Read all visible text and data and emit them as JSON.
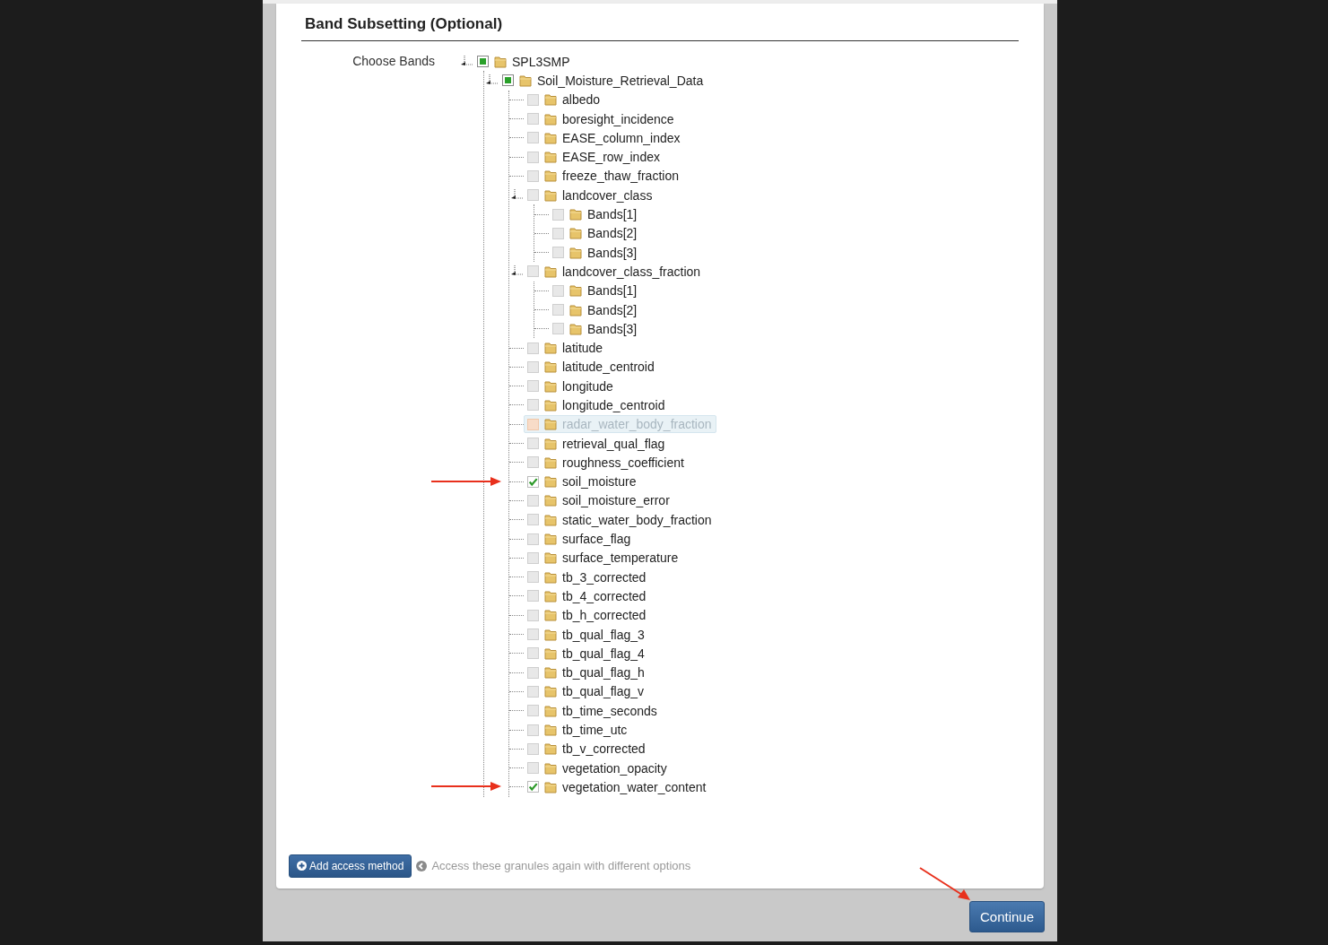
{
  "section": {
    "title": "Band Subsetting (Optional)"
  },
  "field_label": "Choose Bands",
  "tree": [
    {
      "label": "SPL3SMP",
      "checked": false,
      "partial": true,
      "expanded": true,
      "hovered": false,
      "arrow": false,
      "children": [
        {
          "label": "Soil_Moisture_Retrieval_Data",
          "checked": false,
          "partial": true,
          "expanded": true,
          "hovered": false,
          "arrow": false,
          "children": [
            {
              "label": "albedo",
              "checked": false,
              "partial": false,
              "hovered": false,
              "arrow": false
            },
            {
              "label": "boresight_incidence",
              "checked": false,
              "partial": false,
              "hovered": false,
              "arrow": false
            },
            {
              "label": "EASE_column_index",
              "checked": false,
              "partial": false,
              "hovered": false,
              "arrow": false
            },
            {
              "label": "EASE_row_index",
              "checked": false,
              "partial": false,
              "hovered": false,
              "arrow": false
            },
            {
              "label": "freeze_thaw_fraction",
              "checked": false,
              "partial": false,
              "hovered": false,
              "arrow": false
            },
            {
              "label": "landcover_class",
              "checked": false,
              "partial": false,
              "expanded": true,
              "hovered": false,
              "arrow": false,
              "children": [
                {
                  "label": "Bands[1]",
                  "checked": false,
                  "partial": false,
                  "hovered": false,
                  "arrow": false
                },
                {
                  "label": "Bands[2]",
                  "checked": false,
                  "partial": false,
                  "hovered": false,
                  "arrow": false
                },
                {
                  "label": "Bands[3]",
                  "checked": false,
                  "partial": false,
                  "hovered": false,
                  "arrow": false
                }
              ]
            },
            {
              "label": "landcover_class_fraction",
              "checked": false,
              "partial": false,
              "expanded": true,
              "hovered": false,
              "arrow": false,
              "children": [
                {
                  "label": "Bands[1]",
                  "checked": false,
                  "partial": false,
                  "hovered": false,
                  "arrow": false
                },
                {
                  "label": "Bands[2]",
                  "checked": false,
                  "partial": false,
                  "hovered": false,
                  "arrow": false
                },
                {
                  "label": "Bands[3]",
                  "checked": false,
                  "partial": false,
                  "hovered": false,
                  "arrow": false
                }
              ]
            },
            {
              "label": "latitude",
              "checked": false,
              "partial": false,
              "hovered": false,
              "arrow": false
            },
            {
              "label": "latitude_centroid",
              "checked": false,
              "partial": false,
              "hovered": false,
              "arrow": false
            },
            {
              "label": "longitude",
              "checked": false,
              "partial": false,
              "hovered": false,
              "arrow": false
            },
            {
              "label": "longitude_centroid",
              "checked": false,
              "partial": false,
              "hovered": false,
              "arrow": false
            },
            {
              "label": "radar_water_body_fraction",
              "checked": false,
              "partial": false,
              "hovered": true,
              "arrow": false
            },
            {
              "label": "retrieval_qual_flag",
              "checked": false,
              "partial": false,
              "hovered": false,
              "arrow": false
            },
            {
              "label": "roughness_coefficient",
              "checked": false,
              "partial": false,
              "hovered": false,
              "arrow": false
            },
            {
              "label": "soil_moisture",
              "checked": true,
              "partial": false,
              "hovered": false,
              "arrow": true
            },
            {
              "label": "soil_moisture_error",
              "checked": false,
              "partial": false,
              "hovered": false,
              "arrow": false
            },
            {
              "label": "static_water_body_fraction",
              "checked": false,
              "partial": false,
              "hovered": false,
              "arrow": false
            },
            {
              "label": "surface_flag",
              "checked": false,
              "partial": false,
              "hovered": false,
              "arrow": false
            },
            {
              "label": "surface_temperature",
              "checked": false,
              "partial": false,
              "hovered": false,
              "arrow": false
            },
            {
              "label": "tb_3_corrected",
              "checked": false,
              "partial": false,
              "hovered": false,
              "arrow": false
            },
            {
              "label": "tb_4_corrected",
              "checked": false,
              "partial": false,
              "hovered": false,
              "arrow": false
            },
            {
              "label": "tb_h_corrected",
              "checked": false,
              "partial": false,
              "hovered": false,
              "arrow": false
            },
            {
              "label": "tb_qual_flag_3",
              "checked": false,
              "partial": false,
              "hovered": false,
              "arrow": false
            },
            {
              "label": "tb_qual_flag_4",
              "checked": false,
              "partial": false,
              "hovered": false,
              "arrow": false
            },
            {
              "label": "tb_qual_flag_h",
              "checked": false,
              "partial": false,
              "hovered": false,
              "arrow": false
            },
            {
              "label": "tb_qual_flag_v",
              "checked": false,
              "partial": false,
              "hovered": false,
              "arrow": false
            },
            {
              "label": "tb_time_seconds",
              "checked": false,
              "partial": false,
              "hovered": false,
              "arrow": false
            },
            {
              "label": "tb_time_utc",
              "checked": false,
              "partial": false,
              "hovered": false,
              "arrow": false
            },
            {
              "label": "tb_v_corrected",
              "checked": false,
              "partial": false,
              "hovered": false,
              "arrow": false
            },
            {
              "label": "vegetation_opacity",
              "checked": false,
              "partial": false,
              "hovered": false,
              "arrow": false
            },
            {
              "label": "vegetation_water_content",
              "checked": true,
              "partial": false,
              "hovered": false,
              "arrow": true
            }
          ]
        }
      ]
    }
  ],
  "add_button": {
    "label": "Add access method"
  },
  "hint": "Access these granules again with different options",
  "continue_button": {
    "label": "Continue",
    "arrow": true
  }
}
